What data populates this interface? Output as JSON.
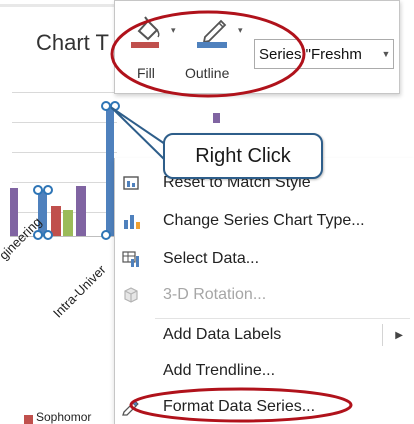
{
  "chart": {
    "title": "Chart T",
    "categories": [
      "gineering",
      "Intra-Univer"
    ],
    "legend": {
      "label": "Sophomor",
      "color": "#c0504d"
    }
  },
  "toolbar": {
    "fill_label": "Fill",
    "outline_label": "Outline",
    "series_select_value": "Series \"Freshm",
    "fill_color": "#c0504d",
    "outline_color": "#4f81bd"
  },
  "callout": {
    "text": "Right Click"
  },
  "context_menu": {
    "items": [
      {
        "label": "Reset to Match Style",
        "icon": "reset-style-icon",
        "enabled": true
      },
      {
        "label": "Change Series Chart Type...",
        "icon": "chart-type-icon",
        "enabled": true
      },
      {
        "label": "Select Data...",
        "icon": "select-data-icon",
        "enabled": true
      },
      {
        "label": "3-D Rotation...",
        "icon": "3d-rotation-icon",
        "enabled": false
      },
      {
        "label": "Add Data Labels",
        "icon": "",
        "enabled": true,
        "submenu": true
      },
      {
        "label": "Add Trendline...",
        "icon": "",
        "enabled": true
      },
      {
        "label": "Format Data Series...",
        "icon": "format-series-icon",
        "enabled": true
      }
    ]
  },
  "colors": {
    "series_blue": "#4f81bd",
    "series_red": "#c0504d",
    "series_green": "#9bbb59",
    "series_purple": "#8064a2",
    "annotation_red": "#b0121b",
    "callout_border": "#2e5e8a"
  }
}
